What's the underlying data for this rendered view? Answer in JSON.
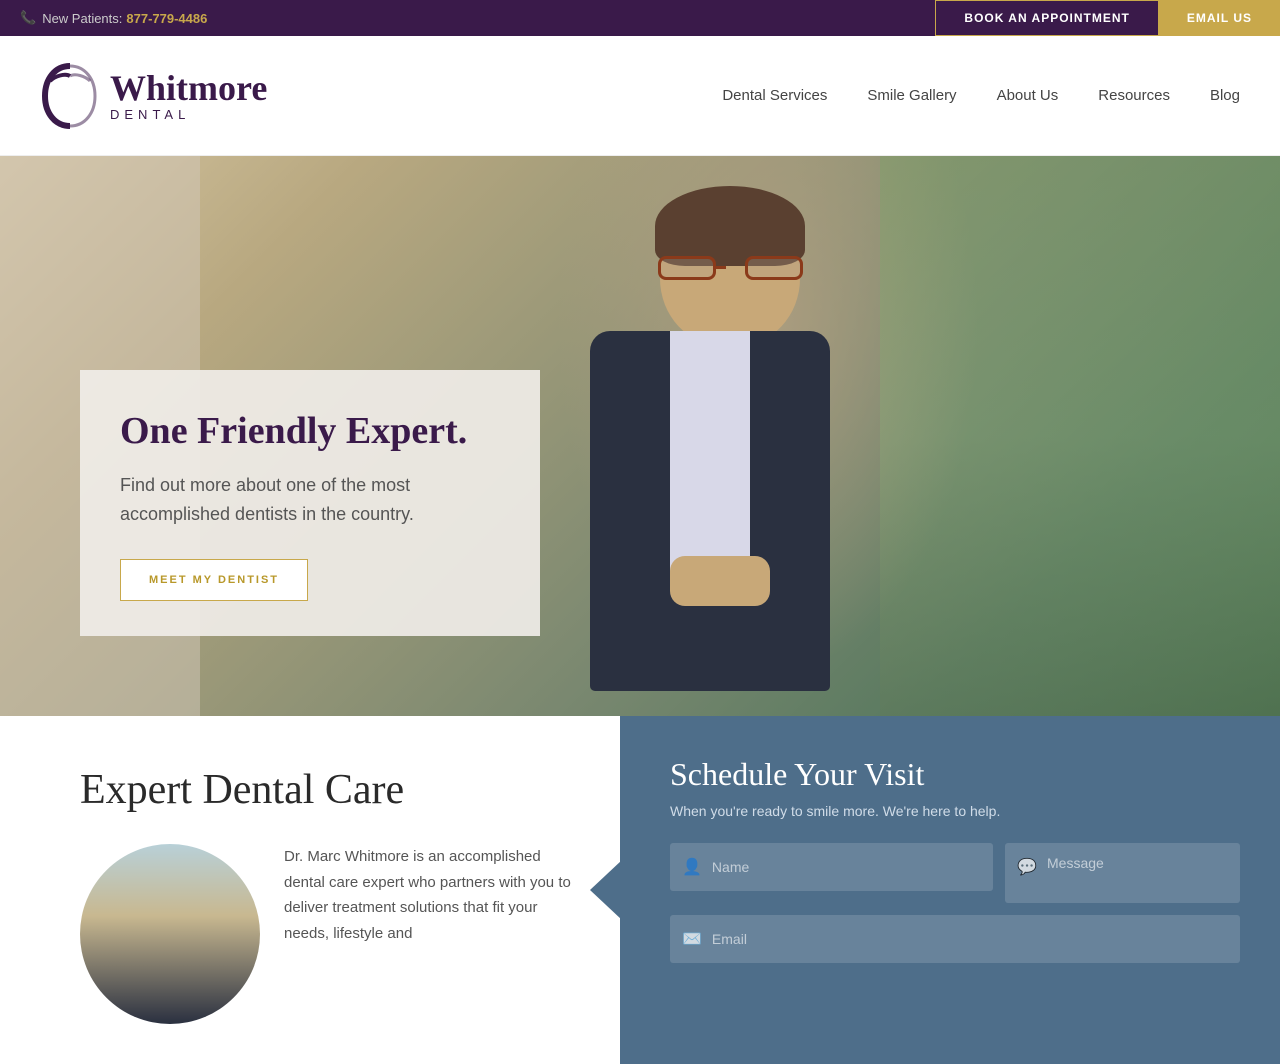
{
  "topbar": {
    "phone_label": "New Patients:",
    "phone_number": "877-779-4486",
    "book_btn": "BOOK AN APPOINTMENT",
    "email_btn": "EMAIL US",
    "phone_icon": "📞"
  },
  "nav": {
    "logo_name": "Whitmore",
    "logo_sub": "DENTAL",
    "links": [
      {
        "label": "Dental Services",
        "id": "dental-services"
      },
      {
        "label": "Smile Gallery",
        "id": "smile-gallery"
      },
      {
        "label": "About Us",
        "id": "about-us"
      },
      {
        "label": "Resources",
        "id": "resources"
      },
      {
        "label": "Blog",
        "id": "blog"
      }
    ]
  },
  "hero": {
    "heading": "One Friendly Expert.",
    "subtext": "Find out more about one of the most accomplished dentists in the country.",
    "cta_label": "MEET MY DENTIST"
  },
  "expert_section": {
    "heading": "Expert Dental Care",
    "bio": "Dr. Marc Whitmore is an accomplished dental care expert who partners with you to deliver treatment solutions that fit your needs, lifestyle and"
  },
  "schedule": {
    "heading": "Schedule Your Visit",
    "subtext": "When you're ready to smile more. We're here to help.",
    "name_placeholder": "Name",
    "message_placeholder": "Message",
    "email_placeholder": "Email"
  }
}
